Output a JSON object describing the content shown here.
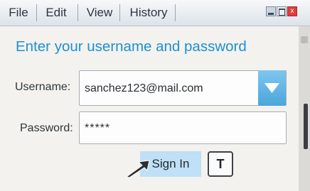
{
  "menu": {
    "items": [
      {
        "label": "File"
      },
      {
        "label": "Edit"
      },
      {
        "label": "View"
      },
      {
        "label": "History"
      }
    ]
  },
  "window_controls": {
    "icons": [
      "minimize-icon",
      "maximize-icon",
      "close-icon"
    ],
    "close_glyph": "x"
  },
  "login": {
    "heading": "Enter your username and password",
    "username_label": "Username:",
    "username_value": "sanchez123@mail.com",
    "password_label": "Password:",
    "password_value": "*****",
    "signin_label": "Sign In",
    "t_button_label": "T"
  },
  "colors": {
    "accent": "#1f8fd1",
    "signin_bg": "#bfe0f6",
    "close_red": "#e23b3b"
  }
}
